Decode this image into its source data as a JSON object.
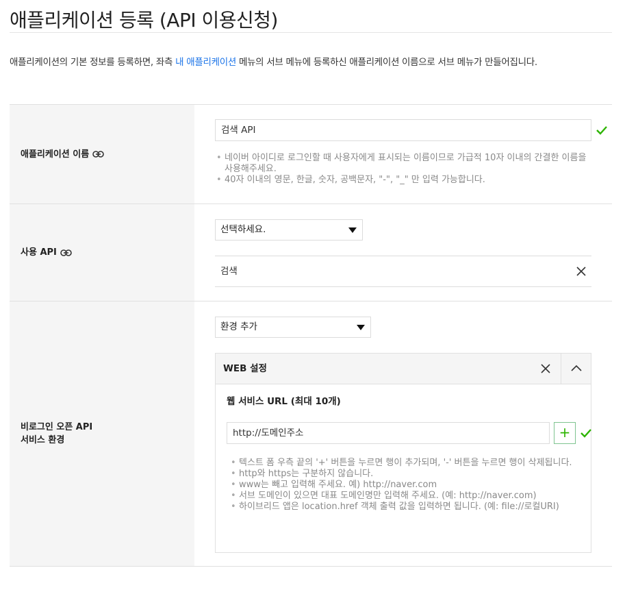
{
  "page": {
    "title": "애플리케이션 등록 (API 이용신청)",
    "desc_pre": "애플리케이션의 기본 정보를 등록하면, 좌측 ",
    "desc_link": "내 애플리케이션",
    "desc_post": " 메뉴의 서브 메뉴에 등록하신 애플리케이션 이름으로 서브 메뉴가 만들어집니다."
  },
  "app_name": {
    "label": "애플리케이션 이름",
    "value": "검색 API",
    "hints": [
      "네이버 아이디로 로그인할 때 사용자에게 표시되는 이름이므로 가급적 10자 이내의 간결한 이름을 사용해주세요.",
      "40자 이내의 영문, 한글, 숫자, 공백문자, \"-\", \"_\" 만 입력 가능합니다."
    ]
  },
  "api": {
    "label": "사용 API",
    "select_value": "선택하세요.",
    "items": [
      "검색"
    ]
  },
  "env": {
    "label": "비로그인 오픈 API\n서비스 환경",
    "select_value": "환경 추가",
    "panel_title": "WEB 설정",
    "url_title": "웹 서비스 URL (최대 10개)",
    "url_value": "http://도메인주소",
    "plus": "+",
    "hints": [
      "텍스트 폼 우측 끝의 '+' 버튼을 누르면 행이 추가되며, '-' 버튼을 누르면 행이 삭제됩니다.",
      "http와 https는 구분하지 않습니다.",
      "www는 빼고 입력해 주세요. 예) http://naver.com",
      "서브 도메인이 있으면 대표 도메인명만 입력해 주세요. (예: http://naver.com)",
      "하이브리드 앱은 location.href 객체 출력 값을 입력하면 됩니다. (예: file://로컬URI)"
    ]
  },
  "colors": {
    "accent_green": "#2db400",
    "link_blue": "#1a73e8"
  }
}
